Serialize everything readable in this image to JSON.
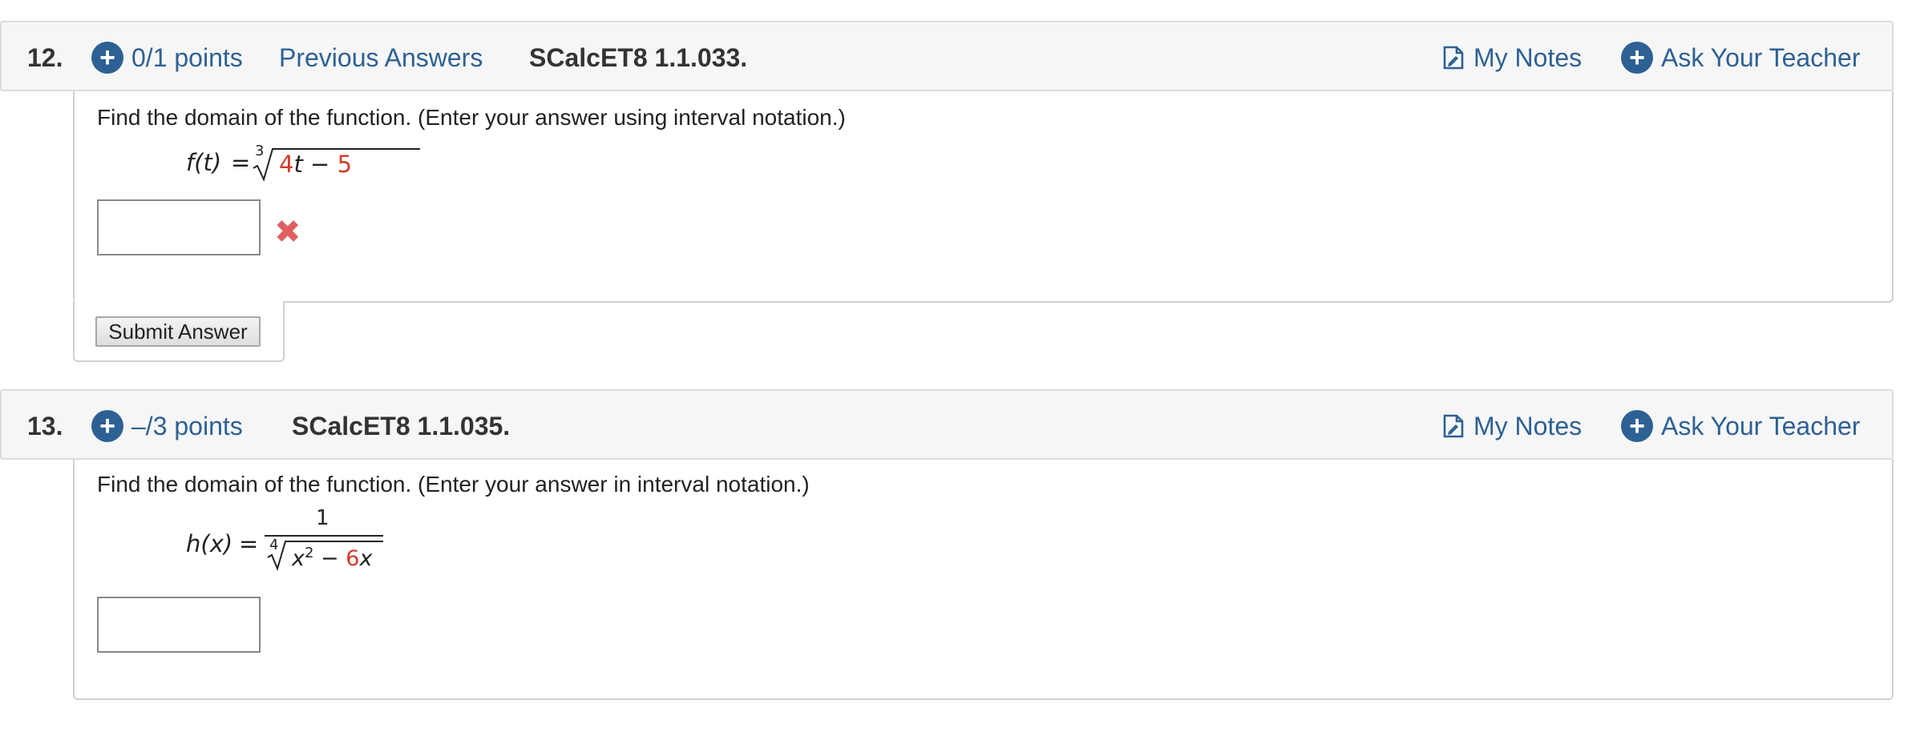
{
  "questions": [
    {
      "number": "12.",
      "points": "0/1 points",
      "previous_answers": "Previous Answers",
      "assignment": "SCalcET8 1.1.033.",
      "my_notes": "My Notes",
      "ask_teacher": "Ask Your Teacher",
      "prompt": "Find the domain of the function. (Enter your answer using interval notation.)",
      "function": {
        "lhs": "f(t)",
        "equals": "=",
        "root_index": "3",
        "radicand_coef": "4",
        "radicand_var": "t",
        "minus": "−",
        "constant": "5"
      },
      "answer_value": "",
      "status_icon": "x-mark-icon",
      "submit_label": "Submit Answer"
    },
    {
      "number": "13.",
      "points": "–/3 points",
      "assignment": "SCalcET8 1.1.035.",
      "my_notes": "My Notes",
      "ask_teacher": "Ask Your Teacher",
      "prompt": "Find the domain of the function. (Enter your answer in interval notation.)",
      "function": {
        "lhs": "h(x)",
        "equals": "=",
        "numerator": "1",
        "root_index": "4",
        "term1_var": "x",
        "term1_exp": "2",
        "minus": "−",
        "term2_coef": "6",
        "term2_var": "x"
      },
      "answer_value": ""
    }
  ],
  "colors": {
    "link": "#2d6194",
    "randomized_value": "#d43a2a",
    "incorrect": "#e06060"
  }
}
